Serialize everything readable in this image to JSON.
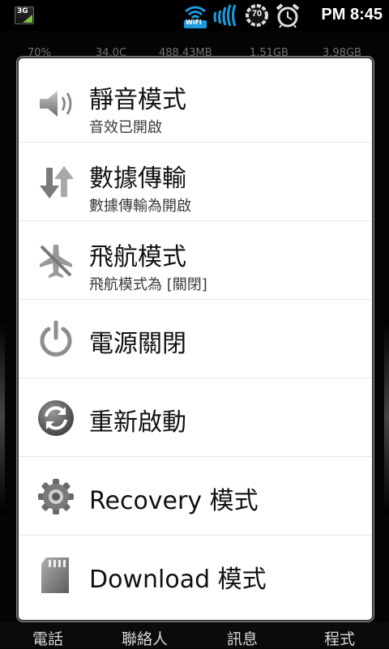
{
  "status_bar": {
    "network": "3G",
    "wifi_label": "WiFi",
    "battery_level": "70",
    "time": "PM 8:45"
  },
  "background_stats": [
    "70%",
    "34.0C",
    "488.43MB",
    "1.51GB",
    "3.98GB"
  ],
  "dialog": {
    "items": [
      {
        "title": "靜音模式",
        "subtitle": "音效已開啟",
        "icon": "speaker-icon"
      },
      {
        "title": "數據傳輸",
        "subtitle": "數據傳輸為開啟",
        "icon": "data-transfer-icon"
      },
      {
        "title": "飛航模式",
        "subtitle": "飛航模式為 [關閉]",
        "icon": "airplane-off-icon"
      },
      {
        "title": "電源關閉",
        "icon": "power-icon"
      },
      {
        "title": "重新啟動",
        "icon": "restart-icon"
      },
      {
        "title": "Recovery 模式",
        "icon": "gear-icon"
      },
      {
        "title": "Download 模式",
        "icon": "sd-card-icon"
      }
    ]
  },
  "dock": [
    "電話",
    "聯絡人",
    "訊息",
    "程式"
  ],
  "colors": {
    "dialog_bg": "#ffffff",
    "text": "#111111",
    "status_bar": "#000000"
  }
}
